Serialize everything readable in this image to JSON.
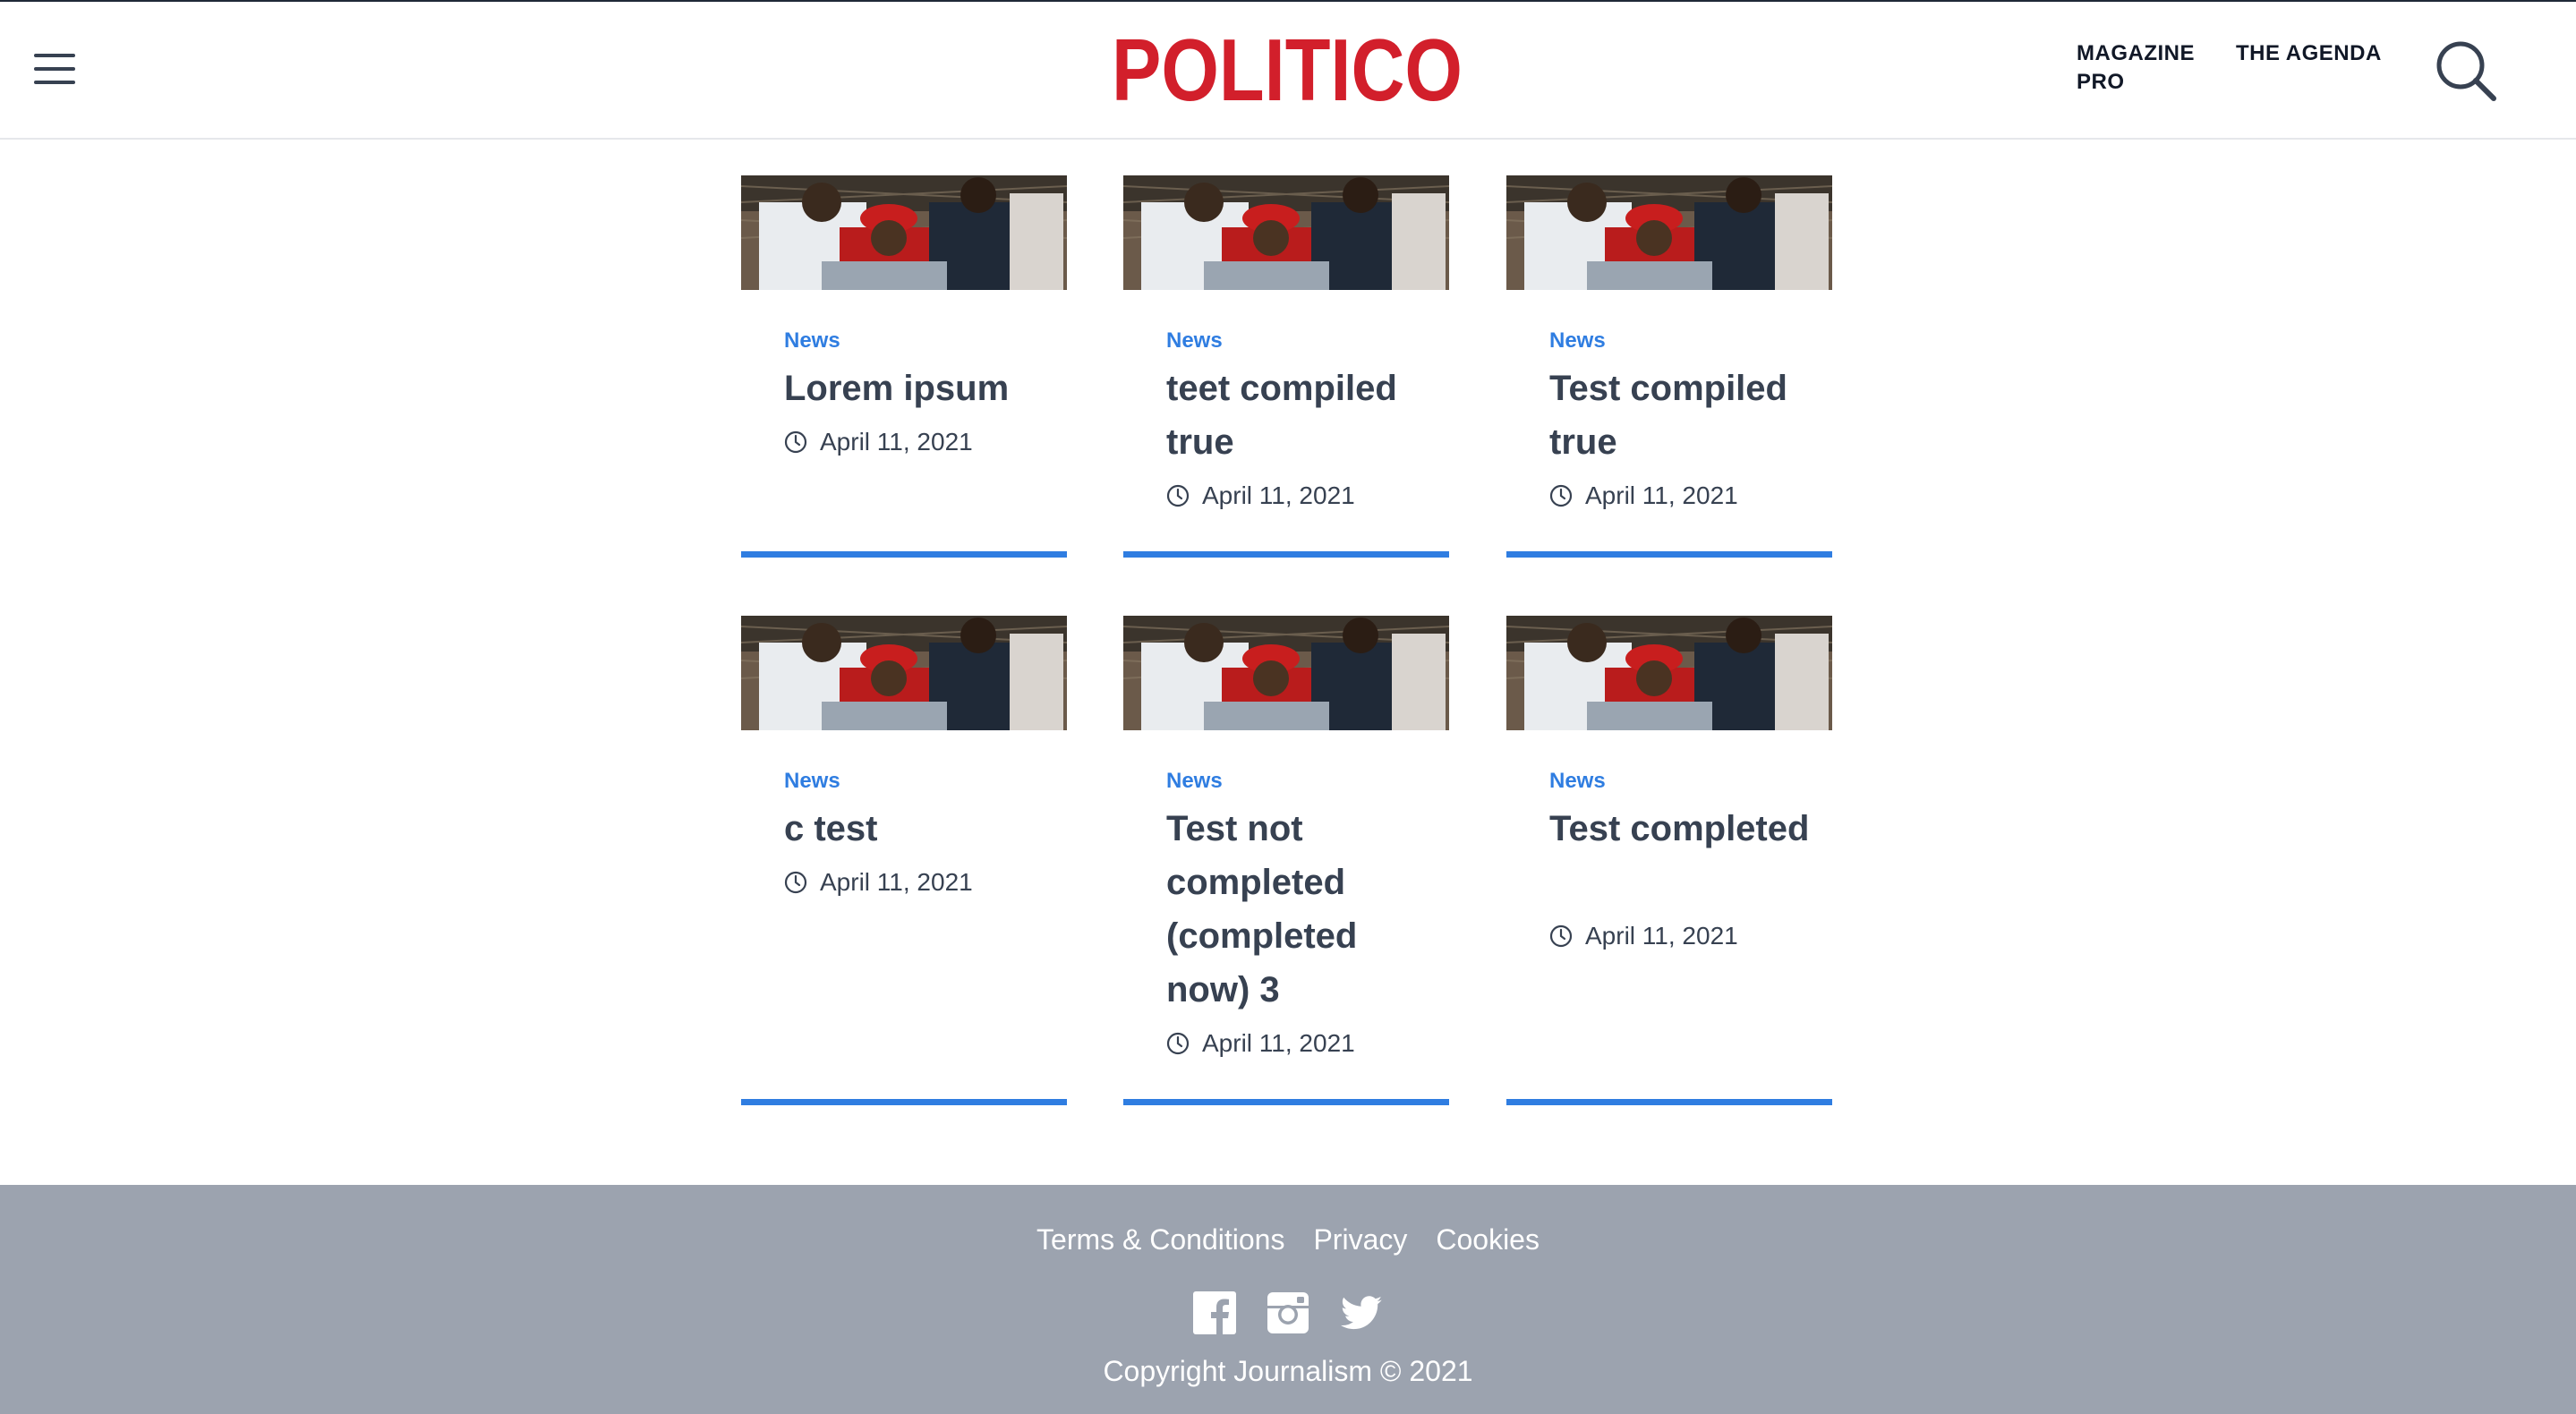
{
  "header": {
    "brand": "POLITICO",
    "brand_color": "#d21f2b",
    "menu_icon": "hamburger-menu-icon",
    "nav": [
      {
        "label": "MAGAZINE PRO"
      },
      {
        "label": "THE AGENDA"
      }
    ],
    "search_icon": "search-icon"
  },
  "articles": [
    {
      "category": "News",
      "title": "Lorem ipsum",
      "date": "April 11, 2021"
    },
    {
      "category": "News",
      "title": "teet compiled true",
      "date": "April 11, 2021"
    },
    {
      "category": "News",
      "title": "Test compiled true",
      "date": "April 11, 2021"
    },
    {
      "category": "News",
      "title": "c test",
      "date": "April 11, 2021"
    },
    {
      "category": "News",
      "title": "Test not completed (completed now) 3",
      "date": "April 11, 2021"
    },
    {
      "category": "News",
      "title": "Test completed",
      "date": "April 11, 2021"
    }
  ],
  "colors": {
    "accent": "#2f7de1",
    "footer_bg": "#9ca3af",
    "text": "#374151"
  },
  "footer": {
    "links": [
      {
        "label": "Terms & Conditions"
      },
      {
        "label": "Privacy"
      },
      {
        "label": "Cookies"
      }
    ],
    "social_icons": [
      "facebook-icon",
      "instagram-icon",
      "twitter-icon"
    ],
    "copyright": "Copyright Journalism © 2021"
  }
}
